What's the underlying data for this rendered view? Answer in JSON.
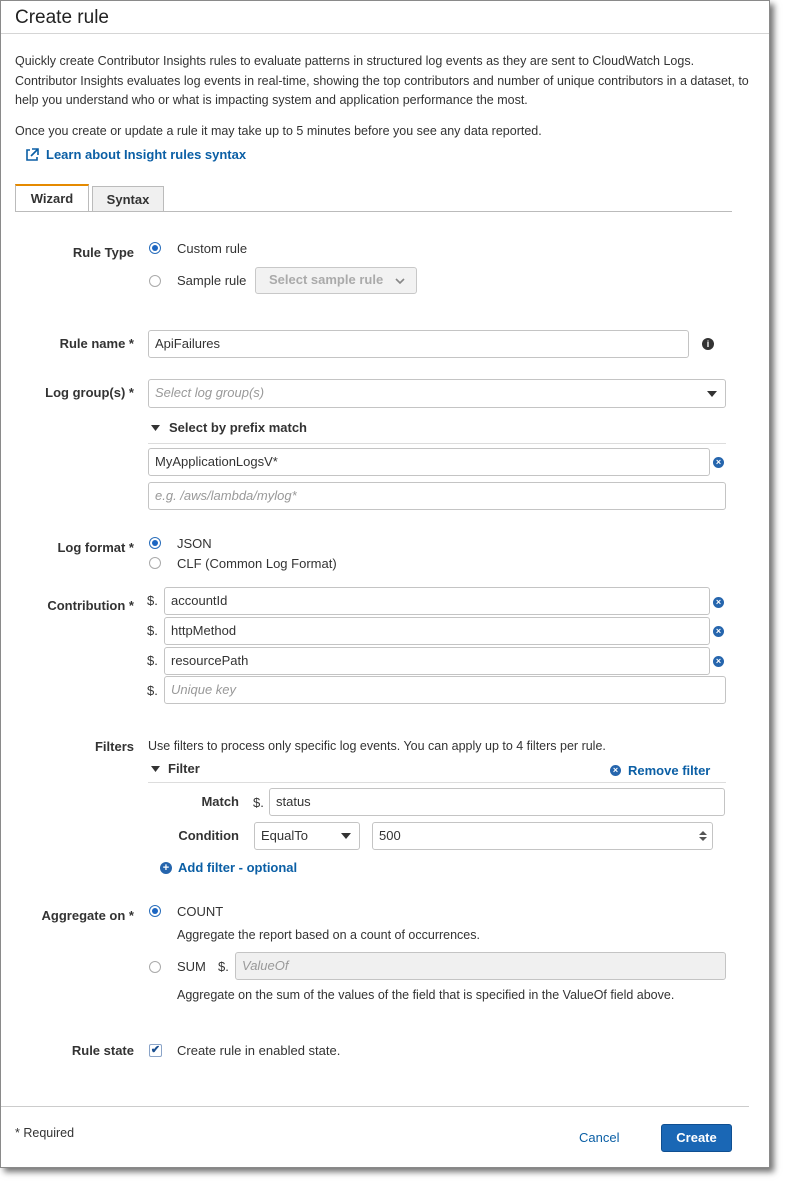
{
  "dialog": {
    "title": "Create rule"
  },
  "intro": {
    "paragraph": "Quickly create Contributor Insights rules to evaluate patterns in structured log events as they are sent to CloudWatch Logs. Contributor Insights evaluates log events in real-time, showing the top contributors and number of unique contributors in a dataset, to help you understand who or what is impacting system and application performance the most.",
    "note": "Once you create or update a rule it may take up to 5 minutes before you see any data reported.",
    "learn_link": "Learn about Insight rules syntax"
  },
  "tabs": [
    {
      "label": "Wizard"
    },
    {
      "label": "Syntax"
    }
  ],
  "rule_type": {
    "label": "Rule Type",
    "custom": "Custom rule",
    "sample": "Sample rule",
    "sample_select": "Select sample rule"
  },
  "rule_name": {
    "label": "Rule name *",
    "value": "ApiFailures"
  },
  "log_groups": {
    "label": "Log group(s) *",
    "placeholder": "Select log group(s)",
    "prefix_heading": "Select by prefix match",
    "prefix_value": "MyApplicationLogsV*",
    "prefix_placeholder": "e.g. /aws/lambda/mylog*"
  },
  "log_format": {
    "label": "Log format *",
    "json": "JSON",
    "clf": "CLF (Common Log Format)"
  },
  "contribution": {
    "label": "Contribution *",
    "prefix": "$.",
    "keys": [
      "accountId",
      "httpMethod",
      "resourcePath"
    ],
    "placeholder": "Unique key"
  },
  "filters": {
    "label": "Filters",
    "description": "Use filters to process only specific log events. You can apply up to 4 filters per rule.",
    "filter_heading": "Filter",
    "remove": "Remove filter",
    "match_label": "Match",
    "match_prefix": "$.",
    "match_value": "status",
    "condition_label": "Condition",
    "condition_value": "EqualTo",
    "condition_amount": "500",
    "add": "Add filter - optional"
  },
  "aggregate": {
    "label": "Aggregate on *",
    "count": "COUNT",
    "count_desc": "Aggregate the report based on a count of occurrences.",
    "sum": "SUM",
    "sum_prefix": "$.",
    "sum_placeholder": "ValueOf",
    "sum_desc": "Aggregate on the sum of the values of the field that is specified in the ValueOf field above."
  },
  "rule_state": {
    "label": "Rule state",
    "checkbox": "Create rule in enabled state."
  },
  "footer": {
    "required": "* Required",
    "cancel": "Cancel",
    "create": "Create"
  },
  "colors": {
    "accent": "#1a67b5",
    "tab_active": "#e58a00"
  }
}
